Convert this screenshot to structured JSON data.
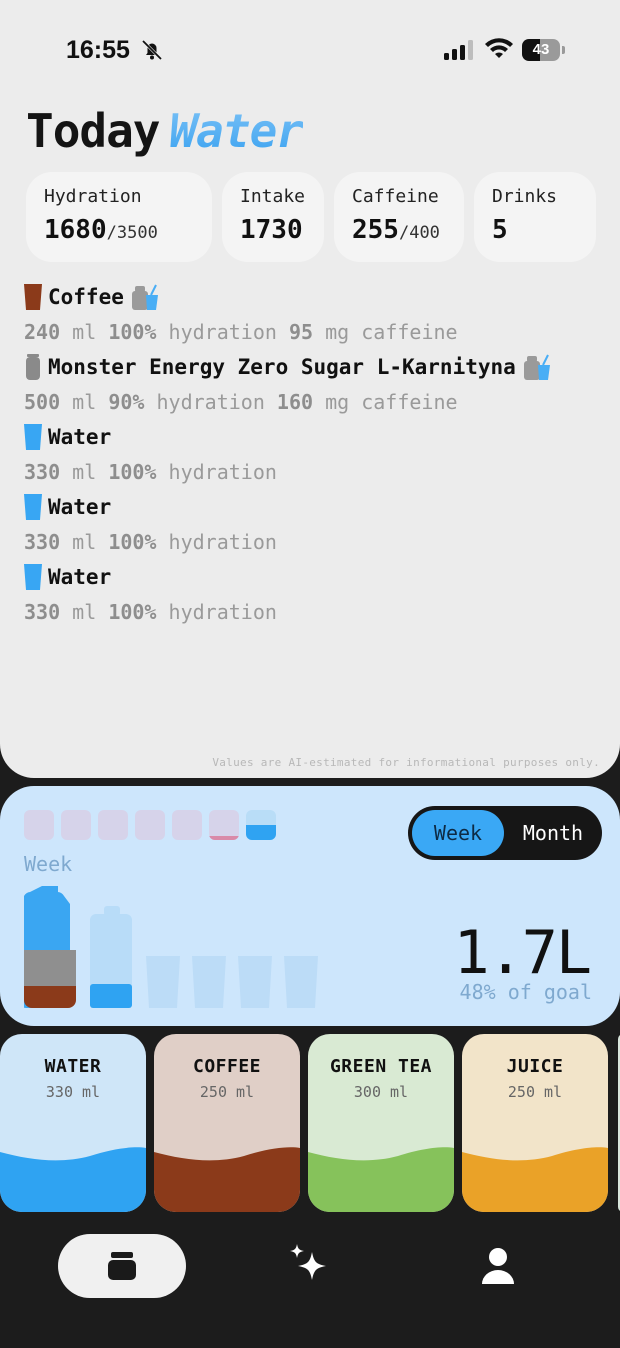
{
  "status": {
    "time": "16:55",
    "battery": "43"
  },
  "header": {
    "title_part1": "Today",
    "title_part2": "Water"
  },
  "stats": {
    "hydration": {
      "label": "Hydration",
      "value": "1680",
      "goal": "/3500"
    },
    "intake": {
      "label": "Intake",
      "value": "1730"
    },
    "caffeine": {
      "label": "Caffeine",
      "value": "255",
      "goal": "/400"
    },
    "drinks": {
      "label": "Drinks",
      "value": "5"
    }
  },
  "entries": [
    {
      "name": "Coffee",
      "volume": "240",
      "unit": "ml",
      "hydration_pct": "100%",
      "hydration_word": "hydration",
      "caffeine": "95",
      "caffeine_unit": "mg",
      "caffeine_word": "caffeine",
      "color": "#8b3a1a",
      "ai_estimated": true
    },
    {
      "name": "Monster Energy Zero Sugar L-Karnityna",
      "volume": "500",
      "unit": "ml",
      "hydration_pct": "90%",
      "hydration_word": "hydration",
      "caffeine": "160",
      "caffeine_unit": "mg",
      "caffeine_word": "caffeine",
      "color": "#8a8a8a",
      "ai_estimated": true
    },
    {
      "name": "Water",
      "volume": "330",
      "unit": "ml",
      "hydration_pct": "100%",
      "hydration_word": "hydration",
      "color": "#38a6f3"
    },
    {
      "name": "Water",
      "volume": "330",
      "unit": "ml",
      "hydration_pct": "100%",
      "hydration_word": "hydration",
      "color": "#38a6f3"
    },
    {
      "name": "Water",
      "volume": "330",
      "unit": "ml",
      "hydration_pct": "100%",
      "hydration_word": "hydration",
      "color": "#38a6f3"
    }
  ],
  "disclaimer": "Values are AI-estimated for informational purposes only.",
  "week": {
    "label": "Week",
    "toggle_week": "Week",
    "toggle_month": "Month",
    "total": "1.7L",
    "goal_text": "48% of goal",
    "day_fill": [
      0,
      0,
      0,
      0,
      0,
      0.12,
      0.5
    ]
  },
  "quick_add": [
    {
      "name": "WATER",
      "volume": "330 ml",
      "bg": "#cfe6f8",
      "fill": "#2fa3f2"
    },
    {
      "name": "COFFEE",
      "volume": "250 ml",
      "bg": "#e0cfc7",
      "fill": "#8b3a1a"
    },
    {
      "name": "GREEN TEA",
      "volume": "300 ml",
      "bg": "#d9ead3",
      "fill": "#86c25b"
    },
    {
      "name": "JUICE",
      "volume": "250 ml",
      "bg": "#f2e4c9",
      "fill": "#eaa228"
    }
  ],
  "tabs": {
    "home": "home-tab",
    "ai": "sparkles-tab",
    "profile": "profile-tab"
  }
}
